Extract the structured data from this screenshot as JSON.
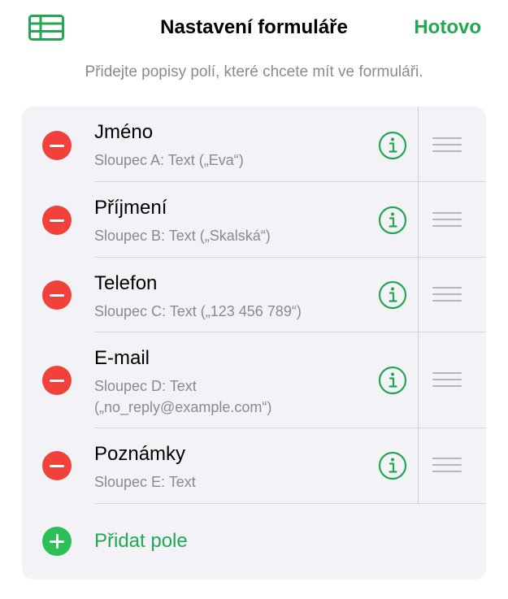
{
  "header": {
    "table_icon": "table-icon",
    "title": "Nastavení formuláře",
    "done_label": "Hotovo"
  },
  "subtitle": "Přidejte popisy polí, které chcete mít ve formuláři.",
  "fields": [
    {
      "name": "Jméno",
      "description": "Sloupec A: Text („Eva“)"
    },
    {
      "name": "Příjmení",
      "description": "Sloupec B: Text („Skalská“)"
    },
    {
      "name": "Telefon",
      "description": "Sloupec C: Text („123 456 789“)"
    },
    {
      "name": "E-mail",
      "description": "Sloupec D: Text\n(„no_reply@example.com“)"
    },
    {
      "name": "Poznámky",
      "description": "Sloupec E: Text"
    }
  ],
  "add_field_label": "Přidat pole",
  "colors": {
    "accent": "#23a852",
    "remove": "#f0413a",
    "add": "#2cbe57",
    "card_bg": "#f2f2f7",
    "secondary_text": "#8a8a8e"
  },
  "icons": {
    "remove": "minus-circle-icon",
    "info": "info-circle-icon",
    "drag": "drag-handle-icon",
    "add": "plus-circle-icon"
  }
}
